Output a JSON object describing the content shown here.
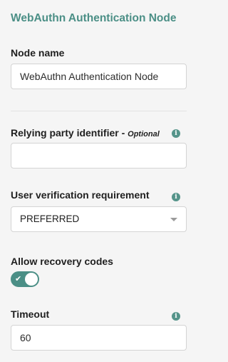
{
  "panel": {
    "title": "WebAuthn Authentication Node"
  },
  "node_name": {
    "label": "Node name",
    "value": "WebAuthn Authentication Node"
  },
  "relying_party": {
    "label": "Relying party identifier - ",
    "optional_label": "Optional",
    "value": "",
    "info_icon": "info-icon"
  },
  "user_verification": {
    "label": "User verification requirement",
    "selected": "PREFERRED",
    "info_icon": "info-icon"
  },
  "recovery_codes": {
    "label": "Allow recovery codes",
    "checked": true,
    "check_glyph": "✔"
  },
  "timeout": {
    "label": "Timeout",
    "value": "60",
    "info_icon": "info-icon"
  },
  "colors": {
    "accent": "#4b8f86",
    "info": "#55948a"
  }
}
